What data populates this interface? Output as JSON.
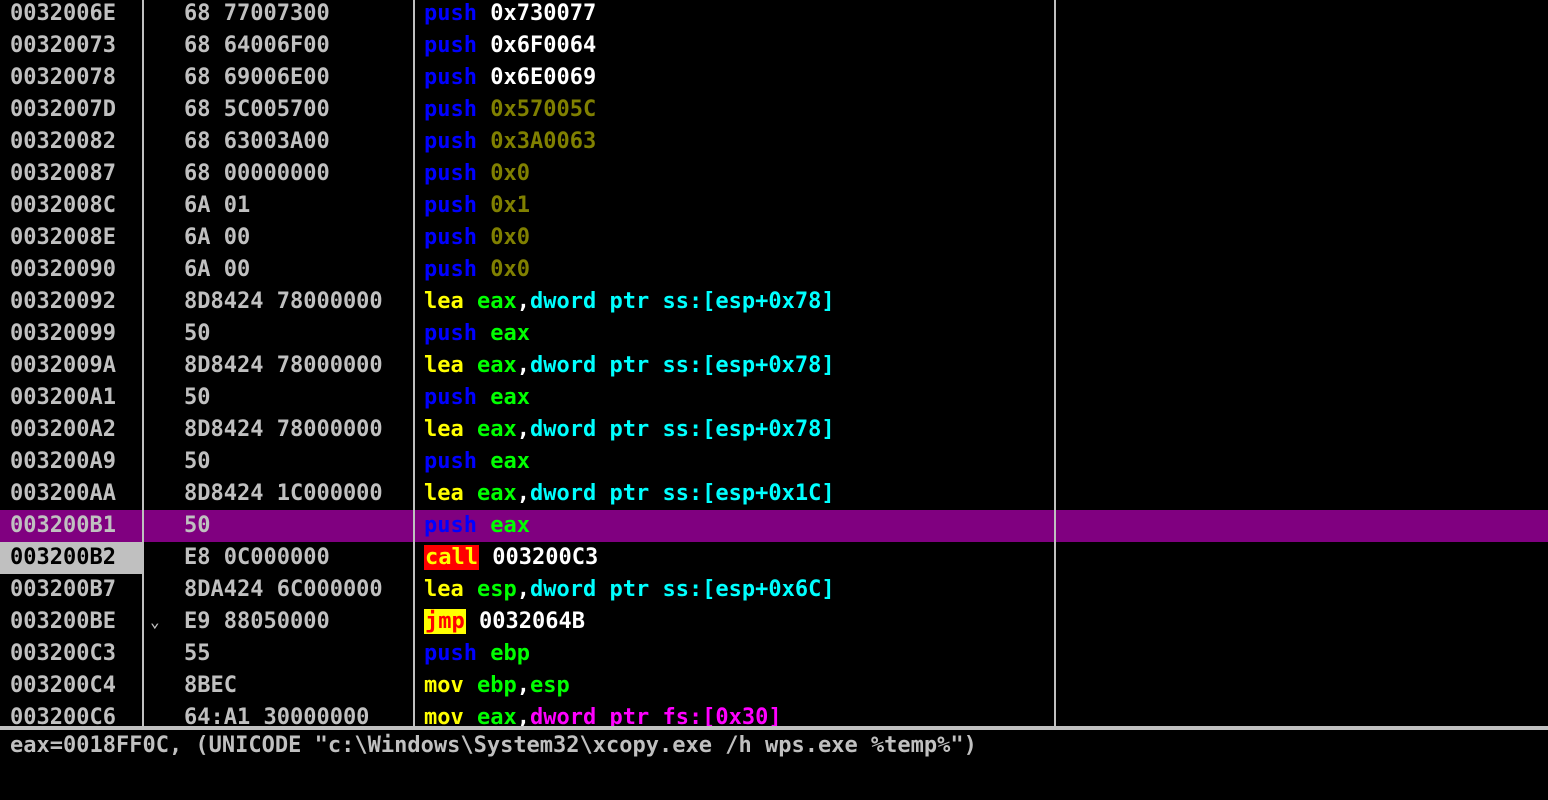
{
  "rows": [
    {
      "address": "0032006E",
      "hex": "68 77007300",
      "instr": [
        {
          "t": "push",
          "c": "push"
        },
        {
          "t": " ",
          "c": "sep"
        },
        {
          "t": "0x730077",
          "c": "imm"
        }
      ]
    },
    {
      "address": "00320073",
      "hex": "68 64006F00",
      "instr": [
        {
          "t": "push",
          "c": "push"
        },
        {
          "t": " ",
          "c": "sep"
        },
        {
          "t": "0x6F0064",
          "c": "imm"
        }
      ]
    },
    {
      "address": "00320078",
      "hex": "68 69006E00",
      "instr": [
        {
          "t": "push",
          "c": "push"
        },
        {
          "t": " ",
          "c": "sep"
        },
        {
          "t": "0x6E0069",
          "c": "imm"
        }
      ]
    },
    {
      "address": "0032007D",
      "hex": "68 5C005700",
      "instr": [
        {
          "t": "push",
          "c": "push"
        },
        {
          "t": " ",
          "c": "sep"
        },
        {
          "t": "0x57005C",
          "c": "imm-dim"
        }
      ]
    },
    {
      "address": "00320082",
      "hex": "68 63003A00",
      "instr": [
        {
          "t": "push",
          "c": "push"
        },
        {
          "t": " ",
          "c": "sep"
        },
        {
          "t": "0x3A0063",
          "c": "imm-dim"
        }
      ]
    },
    {
      "address": "00320087",
      "hex": "68 00000000",
      "instr": [
        {
          "t": "push",
          "c": "push"
        },
        {
          "t": " ",
          "c": "sep"
        },
        {
          "t": "0x0",
          "c": "imm-dim"
        }
      ]
    },
    {
      "address": "0032008C",
      "hex": "6A 01",
      "instr": [
        {
          "t": "push",
          "c": "push"
        },
        {
          "t": " ",
          "c": "sep"
        },
        {
          "t": "0x1",
          "c": "imm-dim"
        }
      ]
    },
    {
      "address": "0032008E",
      "hex": "6A 00",
      "instr": [
        {
          "t": "push",
          "c": "push"
        },
        {
          "t": " ",
          "c": "sep"
        },
        {
          "t": "0x0",
          "c": "imm-dim"
        }
      ]
    },
    {
      "address": "00320090",
      "hex": "6A 00",
      "instr": [
        {
          "t": "push",
          "c": "push"
        },
        {
          "t": " ",
          "c": "sep"
        },
        {
          "t": "0x0",
          "c": "imm-dim"
        }
      ]
    },
    {
      "address": "00320092",
      "hex": "8D8424 78000000",
      "instr": [
        {
          "t": "lea",
          "c": "lea"
        },
        {
          "t": " ",
          "c": "sep"
        },
        {
          "t": "eax",
          "c": "reg"
        },
        {
          "t": ",",
          "c": "sep"
        },
        {
          "t": "dword ptr ss:[esp+0x78]",
          "c": "ptr"
        }
      ]
    },
    {
      "address": "00320099",
      "hex": "50",
      "instr": [
        {
          "t": "push",
          "c": "push"
        },
        {
          "t": " ",
          "c": "sep"
        },
        {
          "t": "eax",
          "c": "reg"
        }
      ]
    },
    {
      "address": "0032009A",
      "hex": "8D8424 78000000",
      "instr": [
        {
          "t": "lea",
          "c": "lea"
        },
        {
          "t": " ",
          "c": "sep"
        },
        {
          "t": "eax",
          "c": "reg"
        },
        {
          "t": ",",
          "c": "sep"
        },
        {
          "t": "dword ptr ss:[esp+0x78]",
          "c": "ptr"
        }
      ]
    },
    {
      "address": "003200A1",
      "hex": "50",
      "instr": [
        {
          "t": "push",
          "c": "push"
        },
        {
          "t": " ",
          "c": "sep"
        },
        {
          "t": "eax",
          "c": "reg"
        }
      ]
    },
    {
      "address": "003200A2",
      "hex": "8D8424 78000000",
      "instr": [
        {
          "t": "lea",
          "c": "lea"
        },
        {
          "t": " ",
          "c": "sep"
        },
        {
          "t": "eax",
          "c": "reg"
        },
        {
          "t": ",",
          "c": "sep"
        },
        {
          "t": "dword ptr ss:[esp+0x78]",
          "c": "ptr"
        }
      ]
    },
    {
      "address": "003200A9",
      "hex": "50",
      "instr": [
        {
          "t": "push",
          "c": "push"
        },
        {
          "t": " ",
          "c": "sep"
        },
        {
          "t": "eax",
          "c": "reg"
        }
      ]
    },
    {
      "address": "003200AA",
      "hex": "8D8424 1C000000",
      "instr": [
        {
          "t": "lea",
          "c": "lea"
        },
        {
          "t": " ",
          "c": "sep"
        },
        {
          "t": "eax",
          "c": "reg"
        },
        {
          "t": ",",
          "c": "sep"
        },
        {
          "t": "dword ptr ss:[esp+0x1C]",
          "c": "ptr"
        }
      ]
    },
    {
      "address": "003200B1",
      "hex": "50",
      "highlight": true,
      "instr": [
        {
          "t": "push",
          "c": "push"
        },
        {
          "t": " ",
          "c": "sep"
        },
        {
          "t": "eax",
          "c": "reg"
        }
      ]
    },
    {
      "address": "003200B2",
      "hex": "E8 0C000000",
      "current": true,
      "instr": [
        {
          "t": "call",
          "c": "call"
        },
        {
          "t": " ",
          "c": "sep"
        },
        {
          "t": "003200C3",
          "c": "imm"
        }
      ]
    },
    {
      "address": "003200B7",
      "hex": "8DA424 6C000000",
      "instr": [
        {
          "t": "lea",
          "c": "lea"
        },
        {
          "t": " ",
          "c": "sep"
        },
        {
          "t": "esp",
          "c": "reg"
        },
        {
          "t": ",",
          "c": "sep"
        },
        {
          "t": "dword ptr ss:[esp+0x6C]",
          "c": "ptr"
        }
      ]
    },
    {
      "address": "003200BE",
      "hex": "E9 88050000",
      "arrow": "⌄",
      "instr": [
        {
          "t": "jmp",
          "c": "jmp"
        },
        {
          "t": " ",
          "c": "sep"
        },
        {
          "t": "0032064B",
          "c": "imm"
        }
      ]
    },
    {
      "address": "003200C3",
      "hex": "55",
      "instr": [
        {
          "t": "push",
          "c": "push"
        },
        {
          "t": " ",
          "c": "sep"
        },
        {
          "t": "ebp",
          "c": "reg"
        }
      ]
    },
    {
      "address": "003200C4",
      "hex": "8BEC",
      "instr": [
        {
          "t": "mov",
          "c": "mov"
        },
        {
          "t": " ",
          "c": "sep"
        },
        {
          "t": "ebp",
          "c": "reg"
        },
        {
          "t": ",",
          "c": "sep"
        },
        {
          "t": "esp",
          "c": "reg"
        }
      ]
    },
    {
      "address": "003200C6",
      "hex": "64:A1 30000000",
      "instr": [
        {
          "t": "mov",
          "c": "mov"
        },
        {
          "t": " ",
          "c": "sep"
        },
        {
          "t": "eax",
          "c": "reg"
        },
        {
          "t": ",",
          "c": "sep"
        },
        {
          "t": "dword ptr fs:[0x30]",
          "c": "ptrfs"
        }
      ]
    }
  ],
  "info": {
    "line": "eax=0018FF0C, (UNICODE \"c:\\Windows\\System32\\xcopy.exe /h wps.exe %temp%\")"
  },
  "colors": {
    "background": "#000000",
    "highlight_row": "#800080",
    "current_address_bg": "#c0c0c0",
    "mnemonic_push": "#0000ff",
    "mnemonic_lea_mov": "#ffff00",
    "register": "#00ff00",
    "memory_ptr": "#00ffff",
    "memory_ptr_fs": "#ff00ff",
    "call_bg": "#ff0000",
    "jmp_bg": "#ffff00"
  },
  "icons": {
    "jump_arrow": "chevron-down-icon"
  }
}
